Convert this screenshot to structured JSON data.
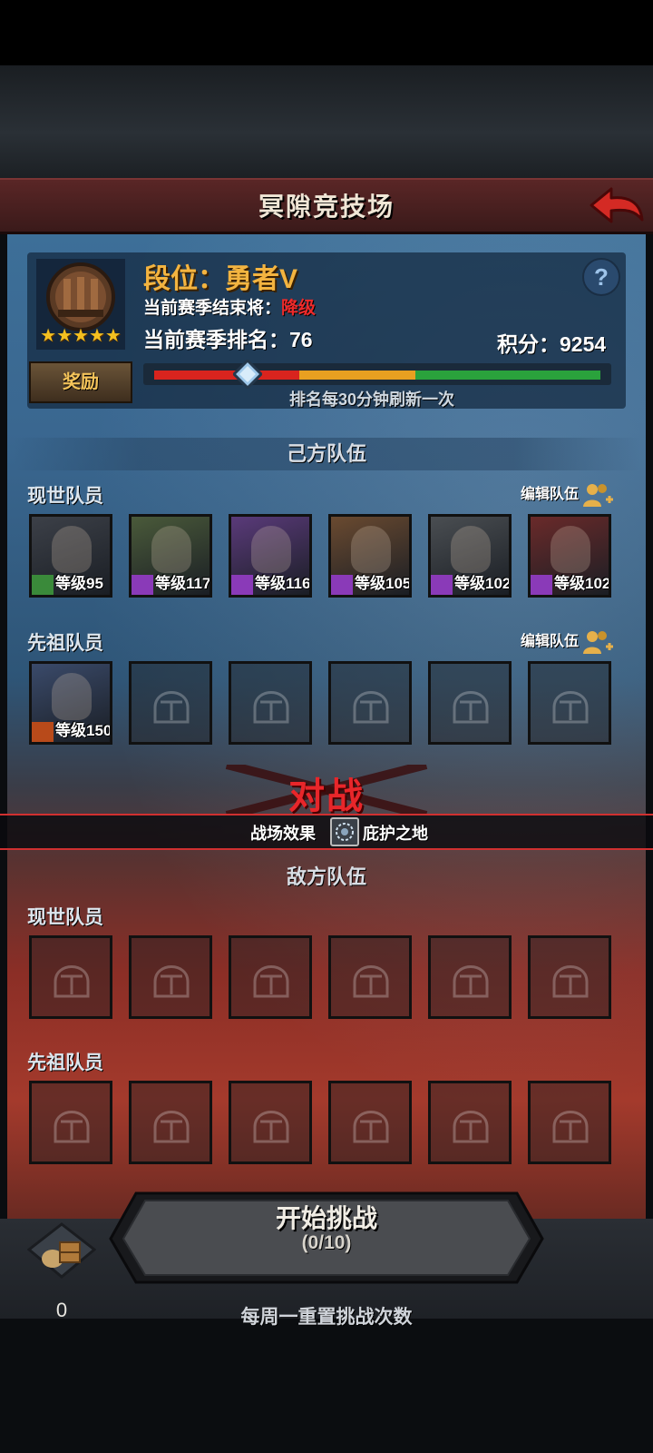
{
  "header": {
    "title": "冥隙竞技场",
    "back_icon": "back-arrow-icon"
  },
  "profile": {
    "rank_label": "段位：勇者V",
    "stars": "★★★★★",
    "season_end_label": "当前赛季结束将：",
    "season_end_status": "降级",
    "season_rank": "当前赛季排名：76",
    "score": "积分：9254",
    "reward_button": "奖励",
    "help_icon": "?",
    "progress_marker_fraction": 0.21,
    "refresh_note": "排名每30分钟刷新一次"
  },
  "own_team": {
    "title": "己方队伍",
    "current_label": "现世队员",
    "ancestor_label": "先祖队员",
    "edit_label": "编辑队伍",
    "current_members": [
      {
        "level": "等级95",
        "class_icon": "bow-class-icon",
        "badge_color": "#3a8a3a",
        "portrait": "#3c4048"
      },
      {
        "level": "等级117",
        "class_icon": "staff-class-icon",
        "badge_color": "#8a3ab8",
        "portrait": "#4a5a3a"
      },
      {
        "level": "等级116",
        "class_icon": "staff-class-icon",
        "badge_color": "#8a3ab8",
        "portrait": "#5a3a7a"
      },
      {
        "level": "等级105",
        "class_icon": "staff-class-icon",
        "badge_color": "#8a3ab8",
        "portrait": "#6a4a30"
      },
      {
        "level": "等级102",
        "class_icon": "staff-class-icon",
        "badge_color": "#8a3ab8",
        "portrait": "#4a4e52"
      },
      {
        "level": "等级102",
        "class_icon": "staff-class-icon",
        "badge_color": "#8a3ab8",
        "portrait": "#6a2a2a"
      }
    ],
    "ancestor_member": {
      "level": "等级150",
      "class_icon": "horse-class-icon",
      "badge_color": "#b84a1a",
      "portrait": "#3a4a6a"
    }
  },
  "battle": {
    "vs_label": "对战",
    "effect_label": "战场效果",
    "effect_name": "庇护之地",
    "effect_icon": "sanctuary-icon"
  },
  "enemy_team": {
    "title": "敌方队伍",
    "current_label": "现世队员",
    "ancestor_label": "先祖队员"
  },
  "footer": {
    "start_label": "开始挑战",
    "start_count": "(0/10)",
    "bag_icon": "supply-bag-icon",
    "bag_count": "0",
    "reset_note": "每周一重置挑战次数"
  },
  "colors": {
    "accent_gold": "#f3b440",
    "warning_red": "#ee2a2a",
    "bar_red": "#d9241e",
    "bar_yellow": "#e8a020",
    "bar_green": "#2aa23c"
  }
}
